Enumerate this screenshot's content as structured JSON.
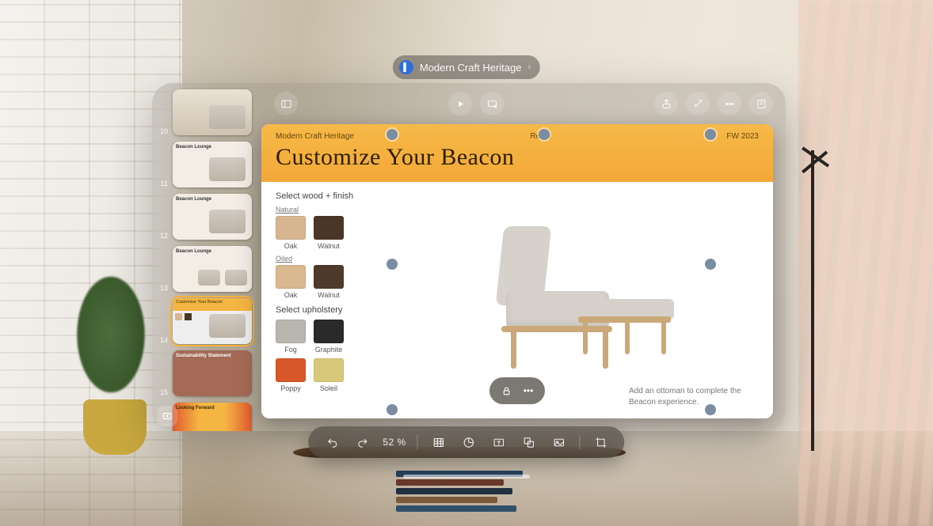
{
  "app_title": "Modern Craft Heritage",
  "toolbar": {
    "sidebar_toggle": "sidebar",
    "play": "play",
    "present_mode": "present-settings",
    "share": "share",
    "magic": "animate",
    "more": "more",
    "inspector": "format-inspector"
  },
  "sidebar": {
    "add_label": "+",
    "slides": [
      {
        "num": "10",
        "title": "",
        "kind": "photo"
      },
      {
        "num": "11",
        "title": "Beacon Lounge",
        "kind": "plain"
      },
      {
        "num": "12",
        "title": "Beacon Lounge",
        "kind": "plain"
      },
      {
        "num": "13",
        "title": "Beacon Lounge",
        "kind": "plain"
      },
      {
        "num": "14",
        "title": "Customize Your Beacon",
        "kind": "banner",
        "selected": true
      },
      {
        "num": "15",
        "title": "Sustainability Statement",
        "kind": "red"
      },
      {
        "num": "",
        "title": "Looking Forward",
        "kind": "grad"
      }
    ]
  },
  "slide": {
    "meta_left": "Modern Craft Heritage",
    "meta_center": "Retail",
    "meta_right": "FW 2023",
    "headline": "Customize Your Beacon",
    "section_wood": "Select wood + finish",
    "group_natural": "Natural",
    "group_oiled": "Oiled",
    "section_upholstery": "Select upholstery",
    "swatches_wood": [
      {
        "label": "Oak",
        "color": "#d7b590"
      },
      {
        "label": "Walnut",
        "color": "#4a3626"
      },
      {
        "label": "Oak",
        "color": "#d9b88f"
      },
      {
        "label": "Walnut",
        "color": "#4d3a2a"
      }
    ],
    "swatches_fabric": [
      {
        "label": "Fog",
        "color": "#b8b4ae"
      },
      {
        "label": "Graphite",
        "color": "#2a2a2a"
      },
      {
        "label": "Poppy",
        "color": "#d8572a"
      },
      {
        "label": "Soleil",
        "color": "#d8c97a"
      }
    ],
    "caption": "Add an ottoman to complete the Beacon experience.",
    "object_pill": {
      "lock": "lock",
      "more": "•••"
    }
  },
  "format_bar": {
    "undo": "undo",
    "redo": "redo",
    "zoom": "52 %",
    "table": "table",
    "chart": "chart",
    "text": "text-box",
    "shape": "shape",
    "media": "media",
    "frame": "crop"
  }
}
